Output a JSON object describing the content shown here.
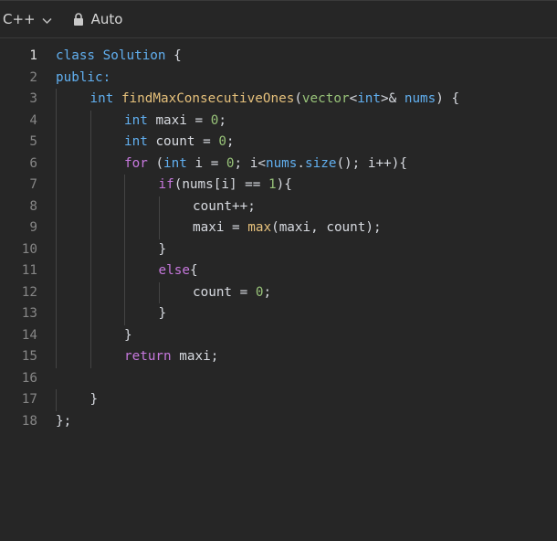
{
  "toolbar": {
    "language": "C++",
    "mode": "Auto",
    "icons": {
      "language_dropdown": "chevron-down-icon",
      "mode": "lock-icon"
    }
  },
  "editor": {
    "active_line": 1,
    "lines": [
      {
        "n": "1",
        "indent": 0,
        "tokens": [
          {
            "t": "class ",
            "c": "t"
          },
          {
            "t": "Solution",
            "c": "t"
          },
          {
            "t": " {",
            "c": "p"
          }
        ]
      },
      {
        "n": "2",
        "indent": 0,
        "tokens": [
          {
            "t": "public:",
            "c": "t"
          }
        ]
      },
      {
        "n": "3",
        "indent": 1,
        "tokens": [
          {
            "t": "int ",
            "c": "t"
          },
          {
            "t": "findMaxConsecutiveOnes",
            "c": "f"
          },
          {
            "t": "(",
            "c": "p"
          },
          {
            "t": "vector",
            "c": "n"
          },
          {
            "t": "<",
            "c": "p"
          },
          {
            "t": "int",
            "c": "t"
          },
          {
            "t": ">& ",
            "c": "p"
          },
          {
            "t": "nums",
            "c": "t"
          },
          {
            "t": ") {",
            "c": "p"
          }
        ]
      },
      {
        "n": "4",
        "indent": 2,
        "tokens": [
          {
            "t": "int ",
            "c": "t"
          },
          {
            "t": "maxi = ",
            "c": "p"
          },
          {
            "t": "0",
            "c": "n"
          },
          {
            "t": ";",
            "c": "p"
          }
        ]
      },
      {
        "n": "5",
        "indent": 2,
        "tokens": [
          {
            "t": "int ",
            "c": "t"
          },
          {
            "t": "count = ",
            "c": "p"
          },
          {
            "t": "0",
            "c": "n"
          },
          {
            "t": ";",
            "c": "p"
          }
        ]
      },
      {
        "n": "6",
        "indent": 2,
        "tokens": [
          {
            "t": "for ",
            "c": "k"
          },
          {
            "t": "(",
            "c": "p"
          },
          {
            "t": "int ",
            "c": "t"
          },
          {
            "t": "i = ",
            "c": "p"
          },
          {
            "t": "0",
            "c": "n"
          },
          {
            "t": "; i<",
            "c": "p"
          },
          {
            "t": "nums",
            "c": "t"
          },
          {
            "t": ".",
            "c": "p"
          },
          {
            "t": "size",
            "c": "t"
          },
          {
            "t": "(); i++){",
            "c": "p"
          }
        ]
      },
      {
        "n": "7",
        "indent": 3,
        "tokens": [
          {
            "t": "if",
            "c": "k"
          },
          {
            "t": "(nums[i] == ",
            "c": "p"
          },
          {
            "t": "1",
            "c": "n"
          },
          {
            "t": "){",
            "c": "p"
          }
        ]
      },
      {
        "n": "8",
        "indent": 4,
        "tokens": [
          {
            "t": "count++;",
            "c": "p"
          }
        ]
      },
      {
        "n": "9",
        "indent": 4,
        "tokens": [
          {
            "t": "maxi = ",
            "c": "p"
          },
          {
            "t": "max",
            "c": "f"
          },
          {
            "t": "(maxi, count);",
            "c": "p"
          }
        ]
      },
      {
        "n": "10",
        "indent": 3,
        "tokens": [
          {
            "t": "}",
            "c": "p"
          }
        ]
      },
      {
        "n": "11",
        "indent": 3,
        "tokens": [
          {
            "t": "else",
            "c": "k"
          },
          {
            "t": "{",
            "c": "p"
          }
        ]
      },
      {
        "n": "12",
        "indent": 4,
        "tokens": [
          {
            "t": "count = ",
            "c": "p"
          },
          {
            "t": "0",
            "c": "n"
          },
          {
            "t": ";",
            "c": "p"
          }
        ]
      },
      {
        "n": "13",
        "indent": 3,
        "tokens": [
          {
            "t": "}",
            "c": "p"
          }
        ]
      },
      {
        "n": "14",
        "indent": 2,
        "tokens": [
          {
            "t": "}",
            "c": "p"
          }
        ]
      },
      {
        "n": "15",
        "indent": 2,
        "tokens": [
          {
            "t": "return ",
            "c": "k"
          },
          {
            "t": "maxi;",
            "c": "p"
          }
        ]
      },
      {
        "n": "16",
        "indent": 0,
        "tokens": []
      },
      {
        "n": "17",
        "indent": 1,
        "tokens": [
          {
            "t": "}",
            "c": "p"
          }
        ]
      },
      {
        "n": "18",
        "indent": 0,
        "tokens": [
          {
            "t": "};",
            "c": "p"
          }
        ]
      }
    ]
  }
}
